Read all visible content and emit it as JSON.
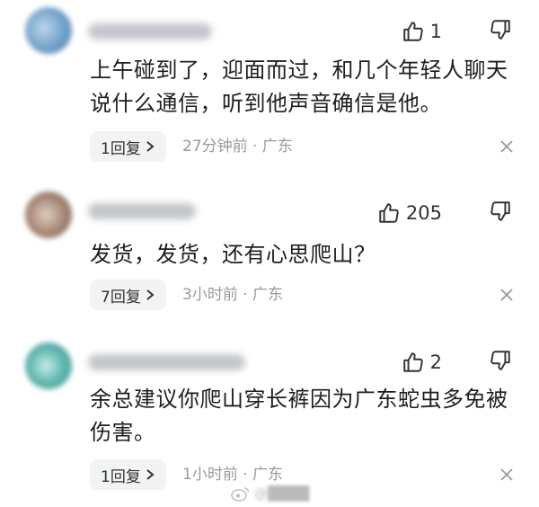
{
  "comments": [
    {
      "likes": "1",
      "text_lines": [
        "上午碰到了，迎面而过，和几个年轻人聊天",
        "说什么通信，听到他声音确信是他。"
      ],
      "reply_label": "1回复",
      "meta": "27分钟前 · 广东"
    },
    {
      "likes": "205",
      "text_lines": [
        "发货，发货，还有心思爬山？"
      ],
      "reply_label": "7回复",
      "meta": "3小时前 · 广东"
    },
    {
      "likes": "2",
      "text_lines": [
        "余总建议你爬山穿长裤因为广东蛇虫多免被",
        "伤害。"
      ],
      "reply_label": "1回复",
      "meta": "1小时前 · 广东"
    }
  ],
  "icons": {
    "like": "thumbs-up-icon",
    "dislike": "thumbs-down-icon",
    "chevron": "chevron-right-icon",
    "close": "close-icon",
    "weibo": "weibo-logo-icon"
  },
  "colors": {
    "avatar_1": "#6fa0c8",
    "avatar_2": "#a88a78",
    "avatar_3": "#5fb7b0"
  }
}
